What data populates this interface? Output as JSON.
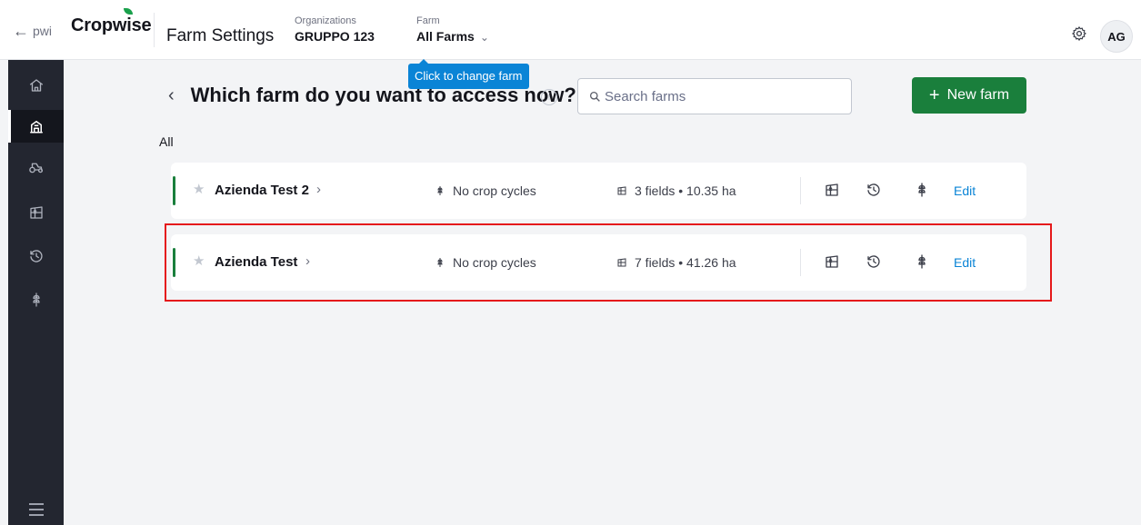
{
  "header": {
    "back_text": "pwi",
    "brand": "Cropwise",
    "page_title": "Farm Settings",
    "org_caption": "Organizations",
    "org_value": "GRUPPO 123",
    "farm_caption": "Farm",
    "farm_value": "All Farms",
    "avatar_initials": "AG"
  },
  "tooltip": "Click to change farm",
  "main": {
    "title": "Which farm do you want to access now?",
    "search_placeholder": "Search farms",
    "new_farm_label": "New farm",
    "section_label": "All"
  },
  "farms": [
    {
      "name": "Azienda Test 2",
      "crop": "No crop cycles",
      "fields": "3 fields • 10.35 ha",
      "edit": "Edit"
    },
    {
      "name": "Azienda Test",
      "crop": "No crop cycles",
      "fields": "7 fields • 41.26 ha",
      "edit": "Edit"
    }
  ],
  "sidebar": {
    "items": [
      "home-icon",
      "farm-icon",
      "machinery-icon",
      "fields-icon",
      "history-icon",
      "crop-icon"
    ],
    "active": "farm-icon"
  },
  "colors": {
    "primary_green": "#1a7f3c",
    "link_blue": "#0a84d6",
    "sidebar_bg": "#232630",
    "highlight_red": "#e5191b"
  }
}
